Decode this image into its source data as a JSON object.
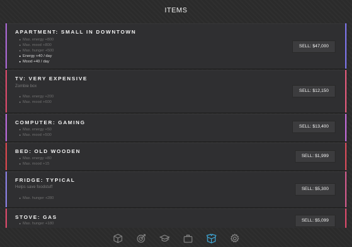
{
  "header": {
    "title": "ITEMS"
  },
  "items": [
    {
      "title": "APARTMENT: SMALL IN DOWNTOWN",
      "description": "",
      "stats": [
        {
          "text": "Max. energy +800",
          "highlight": false
        },
        {
          "text": "Max. mood +800",
          "highlight": false
        },
        {
          "text": "Max. hunger +500",
          "highlight": false
        },
        {
          "text": "Energy +40 / day",
          "highlight": true
        },
        {
          "text": "Mood +40 / day",
          "highlight": true
        }
      ],
      "sell_label": "SELL: $47,000",
      "left_color": "#a867d1",
      "right_color": "#7b73e6"
    },
    {
      "title": "TV: VERY EXPENSIVE",
      "description": "Zombie box",
      "stats": [
        {
          "text": "Max. energy +200",
          "highlight": false
        },
        {
          "text": "Max. mood +600",
          "highlight": false
        }
      ],
      "sell_label": "SELL: $12,150",
      "left_color": "#d84a6a",
      "right_color": "#e05a7a"
    },
    {
      "title": "COMPUTER: GAMING",
      "description": "",
      "stats": [
        {
          "text": "Max. energy +50",
          "highlight": false
        },
        {
          "text": "Max. mood +500",
          "highlight": false
        }
      ],
      "sell_label": "SELL: $13,400",
      "left_color": "#b86ad8",
      "right_color": "#c06ad6"
    },
    {
      "title": "BED: OLD WOODEN",
      "description": "",
      "stats": [
        {
          "text": "Max. energy +80",
          "highlight": false
        },
        {
          "text": "Max. mood +15",
          "highlight": false
        }
      ],
      "sell_label": "SELL: $1,999",
      "left_color": "#d8484e",
      "right_color": "#d64b5a"
    },
    {
      "title": "FRIDGE: TYPICAL",
      "description": "Helps save foodstuff",
      "stats": [
        {
          "text": "Max. hunger +280",
          "highlight": false
        }
      ],
      "sell_label": "SELL: $5,300",
      "left_color": "#8a7fe0",
      "right_color": "#d05a8a"
    },
    {
      "title": "STOVE: GAS",
      "description": "",
      "stats": [
        {
          "text": "Max. hunger +180",
          "highlight": false
        }
      ],
      "sell_label": "SELL: $5,099",
      "left_color": "#d84a6a",
      "right_color": "#d84a6a"
    }
  ],
  "nav": [
    {
      "icon": "cube-icon",
      "active": false
    },
    {
      "icon": "target-icon",
      "active": false
    },
    {
      "icon": "graduation-cap-icon",
      "active": false
    },
    {
      "icon": "briefcase-icon",
      "active": false
    },
    {
      "icon": "box-open-icon",
      "active": true
    },
    {
      "icon": "gear-icon",
      "active": false
    }
  ],
  "colors": {
    "nav_active": "#3fa8d8",
    "nav_inactive": "#8a8a8a"
  }
}
